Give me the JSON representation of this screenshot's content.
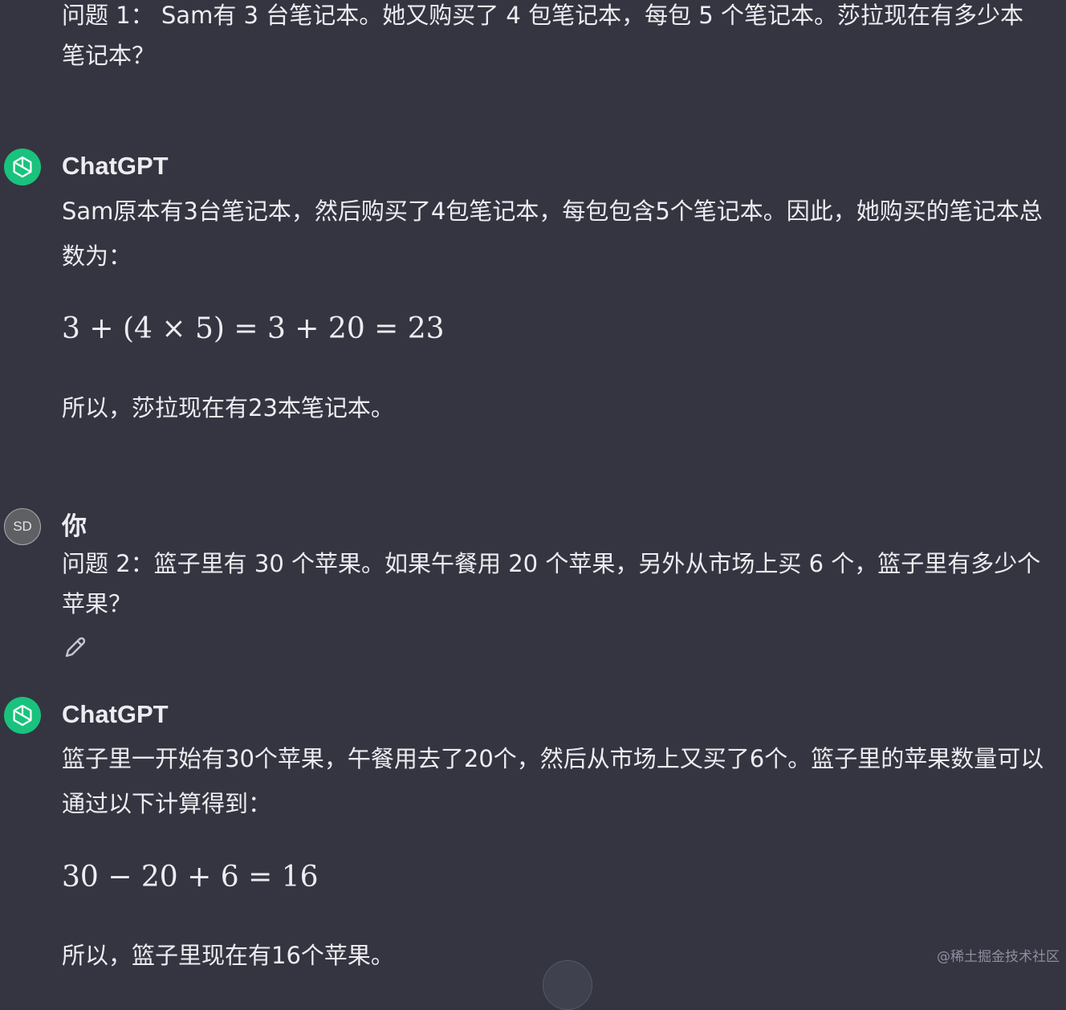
{
  "messages": {
    "q1_text": "问题 1： Sam有 3 台笔记本。她又购买了 4 包笔记本，每包 5 个笔记本。莎拉现在有多少本笔记本？",
    "a1": {
      "author": "ChatGPT",
      "intro": "Sam原本有3台笔记本，然后购买了4包笔记本，每包包含5个笔记本。因此，她购买的笔记本总数为：",
      "equation": "3 + (4 × 5) = 3 + 20 = 23",
      "conclusion": "所以，莎拉现在有23本笔记本。"
    },
    "q2": {
      "author": "你",
      "avatar_initials": "SD",
      "text": "问题 2：篮子里有 30 个苹果。如果午餐用 20 个苹果，另外从市场上买 6 个，篮子里有多少个苹果？"
    },
    "a2": {
      "author": "ChatGPT",
      "intro": "篮子里一开始有30个苹果，午餐用去了20个，然后从市场上又买了6个。篮子里的苹果数量可以通过以下计算得到：",
      "equation": "30 − 20 + 6 = 16",
      "conclusion": "所以，篮子里现在有16个苹果。"
    }
  },
  "icons": {
    "assistant_avatar": "openai-logo-icon",
    "edit": "pencil-icon"
  },
  "watermark": "@稀土掘金技术社区",
  "colors": {
    "background": "#343541",
    "text": "#ececf1",
    "assistant_avatar": "#19c37d",
    "user_avatar": "#5f6064"
  }
}
